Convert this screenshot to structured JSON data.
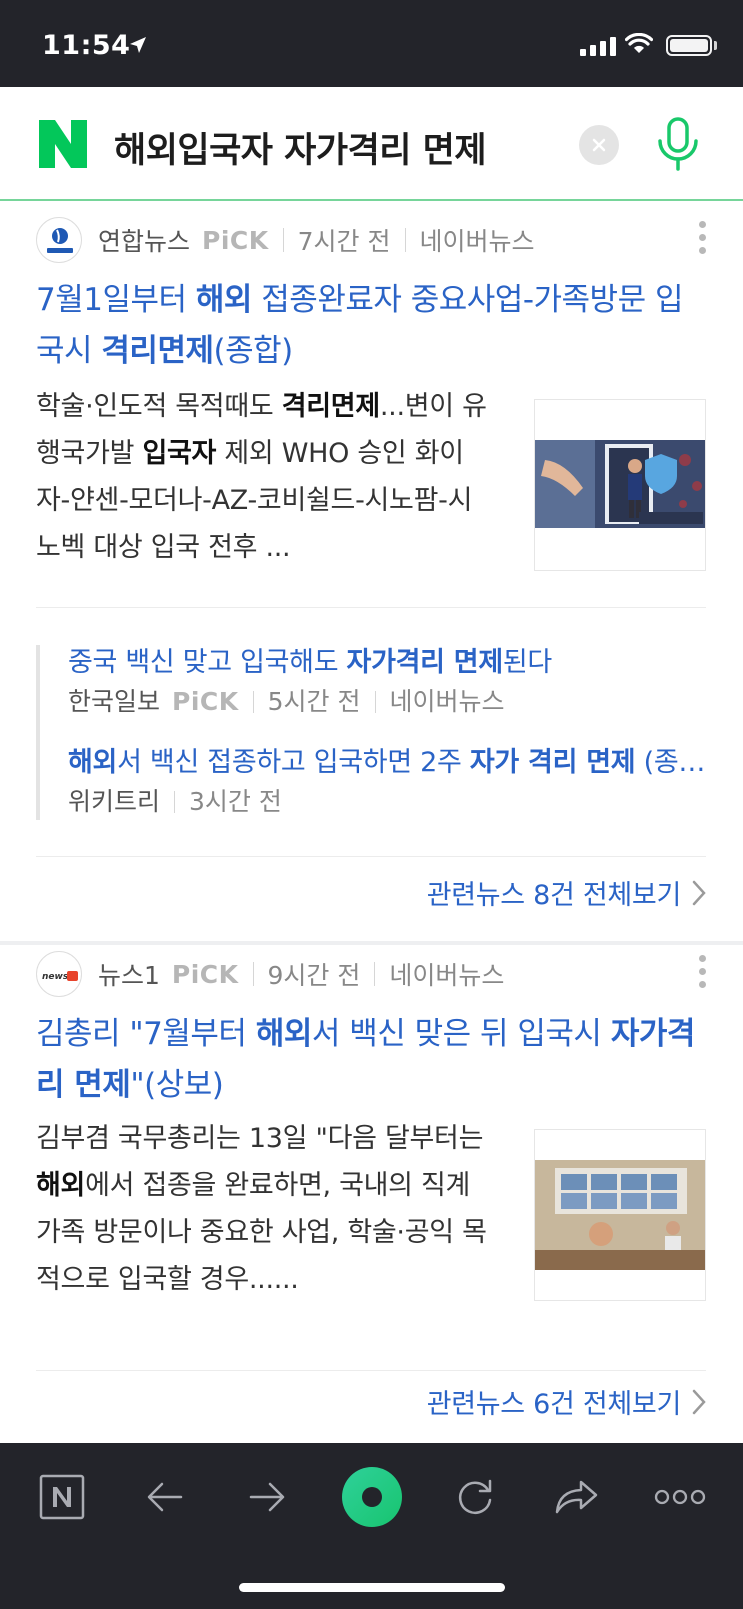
{
  "status_bar": {
    "time": "11:54"
  },
  "search": {
    "query": "해외입국자 자가격리 면제"
  },
  "articles": [
    {
      "source": "연합뉴스",
      "pick": "PiCK",
      "time": "7시간 전",
      "platform": "네이버뉴스",
      "title_parts": [
        "7월1일부터 ",
        "해외",
        " 접종완료자 중요사업-가족방문 입국시 ",
        "격리면제",
        "(종합)"
      ],
      "desc_parts": [
        "학술·인도적 목적때도 ",
        "격리면제",
        "...변이 유행국가발 ",
        "입국자",
        " 제외 WHO 승인 화이자-얀센-모더나-AZ-코비쉴드-시노팜-시노벡 대상 입국 전후 ..."
      ],
      "related": [
        {
          "title_parts": [
            "중국 백신 맞고 입국해도 ",
            "자가격리 면제",
            "된다"
          ],
          "source": "한국일보",
          "pick": "PiCK",
          "time": "5시간 전",
          "platform": "네이버뉴스"
        },
        {
          "title_parts": [
            "해외",
            "서 백신 접종하고 입국하면 2주 ",
            "자가 격리 면제",
            " (종합)"
          ],
          "source": "위키트리",
          "time": "3시간 전"
        }
      ],
      "see_all": "관련뉴스 8건 전체보기"
    },
    {
      "source": "뉴스1",
      "pick": "PiCK",
      "time": "9시간 전",
      "platform": "네이버뉴스",
      "title_parts": [
        "김총리 \"7월부터 ",
        "해외",
        "서 백신 맞은 뒤 입국시 ",
        "자가격리 면제",
        "\"(상보)"
      ],
      "desc_parts": [
        "김부겸 국무총리는 13일 \"다음 달부터는 ",
        "해외",
        "에서 접종을 완료하면, 국내의 직계가족 방문이나 중요한 사업, 학술·공익 목적으로 입국할 경우......"
      ],
      "see_all": "관련뉴스 6건 전체보기"
    }
  ],
  "colors": {
    "link": "#2a63c6",
    "naver_green": "#03c75a",
    "bar": "#23242a"
  }
}
